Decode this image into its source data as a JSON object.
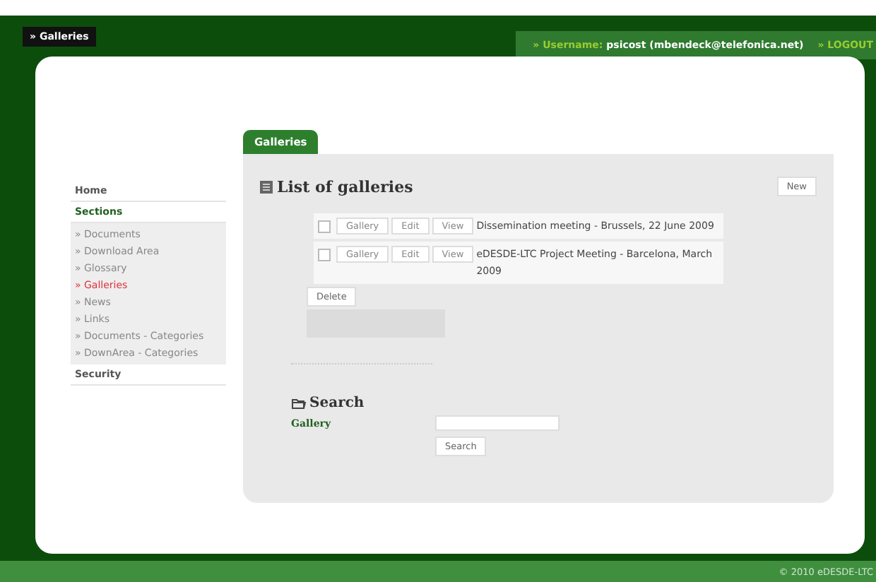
{
  "header": {
    "breadcrumb": "» Galleries",
    "user_label": "» Username:",
    "user": "psicost (mbendeck@telefonica.net)",
    "logout": "» LOGOUT"
  },
  "sidebar": {
    "items": [
      {
        "label": "Home",
        "kind": "heading",
        "selected": false
      },
      {
        "label": "Sections",
        "kind": "heading",
        "selected": true
      },
      {
        "label": "» Documents",
        "kind": "link",
        "selected": false
      },
      {
        "label": "» Download Area",
        "kind": "link",
        "selected": false
      },
      {
        "label": "» Glossary",
        "kind": "link",
        "selected": false
      },
      {
        "label": "» Galleries",
        "kind": "link",
        "selected": true
      },
      {
        "label": "» News",
        "kind": "link",
        "selected": false
      },
      {
        "label": "» Links",
        "kind": "link",
        "selected": false
      },
      {
        "label": "» Documents - Categories",
        "kind": "link",
        "selected": false
      },
      {
        "label": "» DownArea - Categories",
        "kind": "link",
        "selected": false
      },
      {
        "label": "Security",
        "kind": "heading",
        "selected": false
      }
    ]
  },
  "tab": {
    "label": "Galleries",
    "selected": true
  },
  "list": {
    "title": "List of galleries",
    "new_button": "New",
    "rows": [
      {
        "checked": false,
        "buttons": [
          "Gallery",
          "Edit",
          "View"
        ],
        "title": "Dissemination meeting - Brussels, 22 June 2009"
      },
      {
        "checked": false,
        "buttons": [
          "Gallery",
          "Edit",
          "View"
        ],
        "title": "eDESDE-LTC Project Meeting - Barcelona, March 2009"
      }
    ],
    "delete_button": "Delete"
  },
  "search": {
    "title": "Search",
    "label": "Gallery",
    "button": "Search"
  },
  "footer": "© 2010 eDESDE-LTC"
}
